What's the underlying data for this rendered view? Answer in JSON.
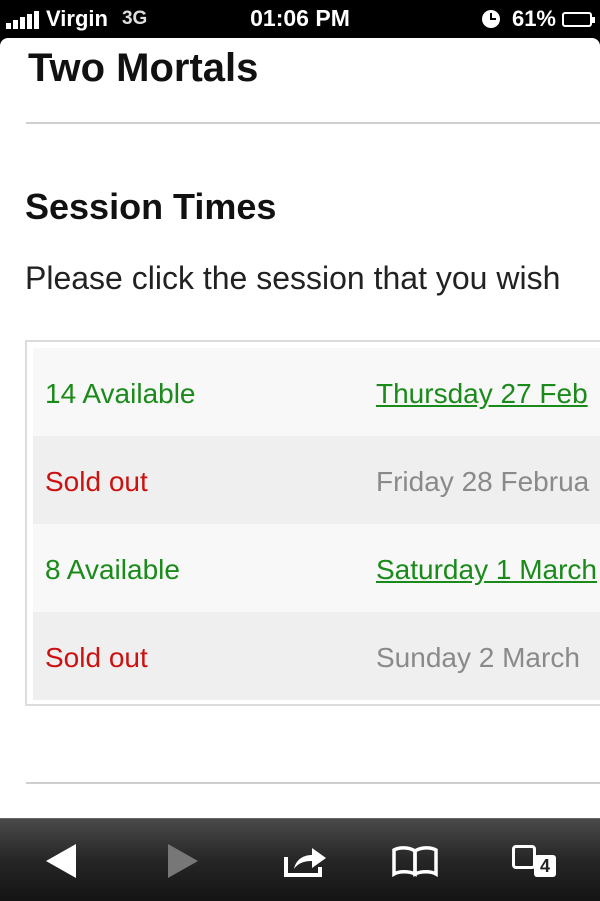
{
  "status_bar": {
    "carrier": "Virgin",
    "network": "3G",
    "time": "01:06 PM",
    "battery_percent": "61%",
    "battery_level": 0.61
  },
  "page": {
    "show_title": "Two Mortals",
    "section_title": "Session Times",
    "instructions": "Please click the session that you wish",
    "sessions": [
      {
        "status": "14 Available",
        "date": "Thursday 27 Feb",
        "available": true
      },
      {
        "status": "Sold out",
        "date": "Friday 28 Februa",
        "available": false
      },
      {
        "status": "8 Available",
        "date": "Saturday 1 March",
        "available": true
      },
      {
        "status": "Sold out",
        "date": "Sunday 2 March",
        "available": false
      }
    ]
  },
  "toolbar": {
    "tab_count": "4",
    "icons": [
      "back-icon",
      "forward-icon",
      "share-icon",
      "bookmarks-icon",
      "tabs-icon"
    ]
  }
}
